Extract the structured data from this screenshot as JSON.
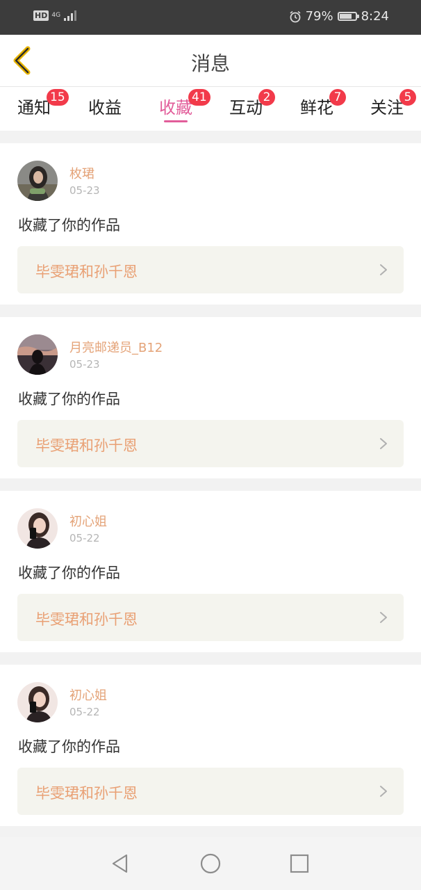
{
  "status_bar": {
    "hd": "HD",
    "network": "4G",
    "battery_percent": "79%",
    "battery_level": 0.79,
    "time": "8:24",
    "icons": [
      "hd-icon",
      "signal-icon",
      "alarm-icon",
      "battery-icon"
    ]
  },
  "header": {
    "title": "消息",
    "back_icon": "back-chevron-icon",
    "accent_color": "#e8b400"
  },
  "tabs": [
    {
      "label": "通知",
      "badge": "15",
      "active": false
    },
    {
      "label": "收益",
      "badge": "",
      "active": false
    },
    {
      "label": "收藏",
      "badge": "41",
      "active": true
    },
    {
      "label": "互动",
      "badge": "2",
      "active": false
    },
    {
      "label": "鲜花",
      "badge": "7",
      "active": false
    },
    {
      "label": "关注",
      "badge": "5",
      "active": false
    }
  ],
  "colors": {
    "active_tab": "#e25d9a",
    "badge": "#f23a4a",
    "username": "#e4a378",
    "work_title": "#e9a074"
  },
  "items": [
    {
      "username": "枚珺",
      "date": "05-23",
      "action": "收藏了你的作品",
      "work_title": "毕雯珺和孙千恩"
    },
    {
      "username": "月亮邮递员_B12",
      "date": "05-23",
      "action": "收藏了你的作品",
      "work_title": "毕雯珺和孙千恩"
    },
    {
      "username": "初心姐",
      "date": "05-22",
      "action": "收藏了你的作品",
      "work_title": "毕雯珺和孙千恩"
    },
    {
      "username": "初心姐",
      "date": "05-22",
      "action": "收藏了你的作品",
      "work_title": "毕雯珺和孙千恩"
    }
  ],
  "nav_bar": {
    "icons": [
      "back-triangle-icon",
      "home-circle-icon",
      "recents-square-icon"
    ]
  }
}
